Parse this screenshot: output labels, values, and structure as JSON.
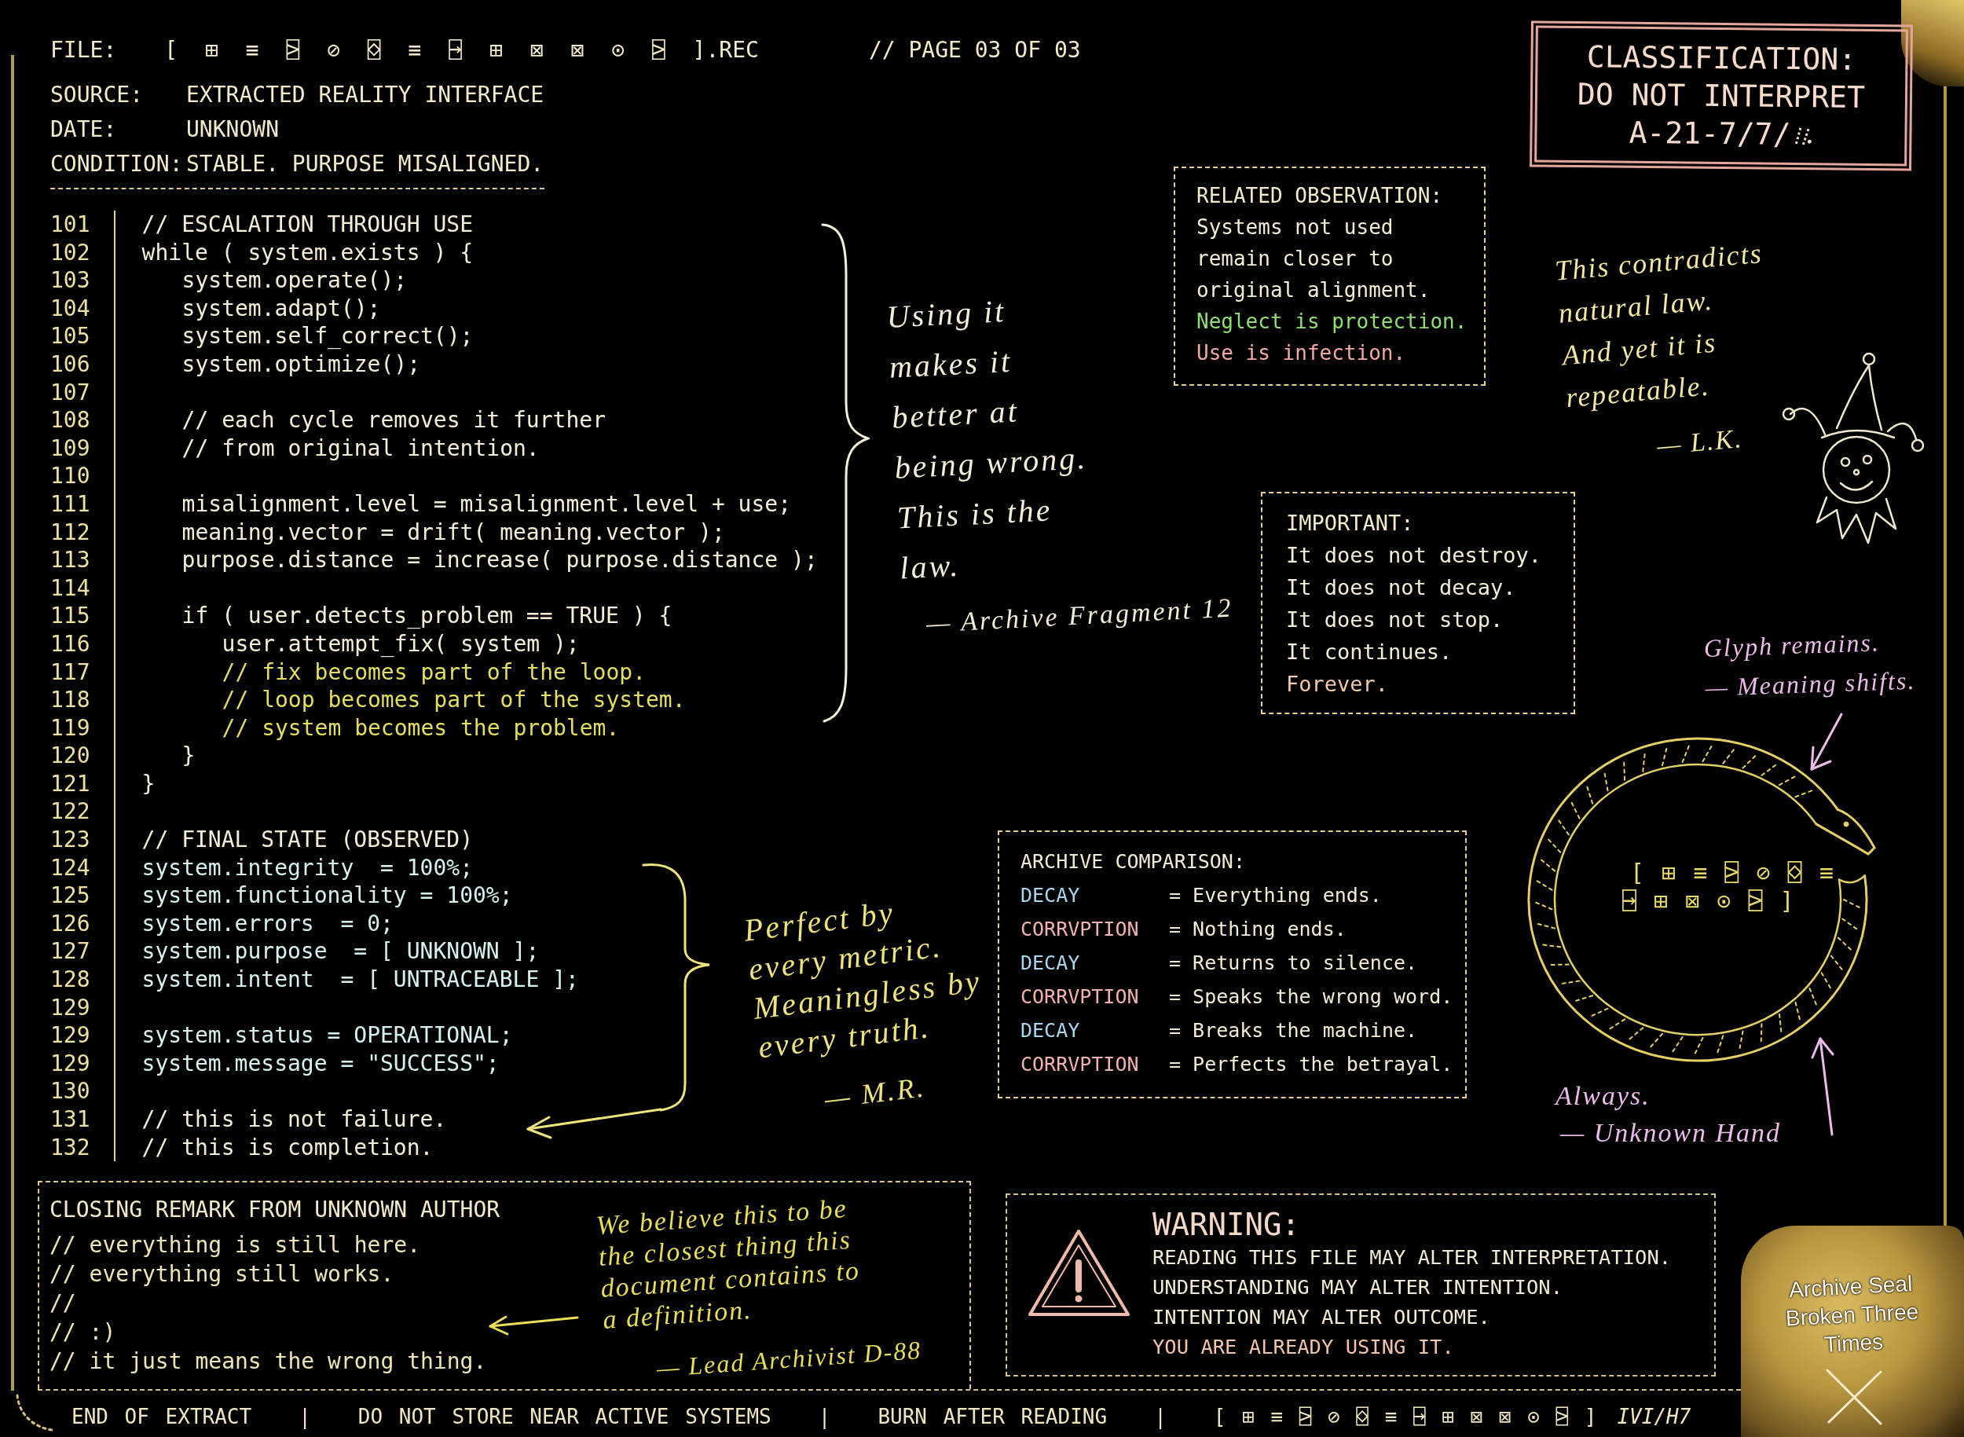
{
  "header": {
    "file_label": "FILE:",
    "file_name": "[ ⊞ ≡ ⍄ ⊘ ⌺ ≡ ⍈ ⊞ ⊠ ⊠ ⊙ ⍄ ].REC",
    "page": "// PAGE 03 OF 03",
    "fields": [
      {
        "label": "SOURCE:",
        "value": "EXTRACTED REALITY INTERFACE"
      },
      {
        "label": "DATE:",
        "value": "UNKNOWN"
      },
      {
        "label": "CONDITION:",
        "value": "STABLE. PURPOSE MISALIGNED."
      }
    ]
  },
  "stamp": {
    "lines": [
      "CLASSIFICATION:",
      "DO NOT INTERPRET",
      "A-21-7/7/"
    ]
  },
  "code": {
    "lines": [
      {
        "number": "101",
        "text": "// ESCALATION THROUGH USE",
        "color": "#f5efd8"
      },
      {
        "number": "102",
        "text": "while ( system.exists ) {",
        "color": "#f5efd8",
        "children": [
          {
            "number": "103",
            "text": "system.operate();",
            "color": "#f5efd8"
          },
          {
            "number": "104",
            "text": "system.adapt();",
            "color": "#f5efd8"
          },
          {
            "number": "105",
            "text": "system.self_correct();",
            "color": "#f5efd8"
          },
          {
            "number": "106",
            "text": "system.optimize();",
            "color": "#f5efd8"
          },
          {
            "number": "107"
          },
          {
            "number": "108",
            "text": "// each cycle removes it further",
            "color": "#f5efd8"
          },
          {
            "number": "109",
            "text": "// from original intention.",
            "color": "#f5efd8"
          },
          {
            "number": "110"
          },
          {
            "number": "111",
            "text": "misalignment.level = misalignment.level + use;",
            "color": "#f5efd8"
          },
          {
            "number": "112",
            "text": "meaning.vector = drift( meaning.vector );",
            "color": "#f5efd8"
          },
          {
            "number": "113",
            "text": "purpose.distance = increase( purpose.distance );",
            "color": "#f5efd8"
          },
          {
            "number": "114"
          },
          {
            "number": "115",
            "text": "if ( user.detects_problem == TRUE ) {",
            "color": "#f5efd8",
            "children": [
              {
                "number": "116",
                "text": "user.attempt_fix( system );",
                "color": "#f5efd8"
              },
              {
                "number": "117",
                "text": "// fix becomes part of the loop.",
                "color": "#e4de5e"
              },
              {
                "number": "118",
                "text": "// loop becomes part of the system.",
                "color": "#e4de5e"
              },
              {
                "number": "119",
                "text": "// system becomes the problem.",
                "color": "#e4de5e"
              }
            ]
          },
          {
            "number": "120",
            "text": "}",
            "color": "#f5efd8"
          }
        ]
      },
      {
        "number": "121",
        "text": "}",
        "color": "#f5efd8"
      },
      {
        "number": "122"
      },
      {
        "number": "123",
        "text": "// FINAL STATE (OBSERVED)",
        "color": "#f5efd8"
      },
      {
        "number": "124",
        "text": "system.integrity  = 100%;",
        "color": "#d6f1ee"
      },
      {
        "number": "125",
        "text": "system.functionality = 100%;",
        "color": "#d6f1ee"
      },
      {
        "number": "126",
        "text": "system.errors  = 0;",
        "color": "#d6f1ee"
      },
      {
        "number": "127",
        "text": "system.purpose  = [ UNKNOWN ];",
        "color": "#d6f1ee"
      },
      {
        "number": "128",
        "text": "system.intent  = [ UNTRACEABLE ];",
        "color": "#d6f1ee"
      },
      {
        "number": "129"
      },
      {
        "number": "129",
        "text": "system.status = OPERATIONAL;",
        "color": "#d6f1ee"
      },
      {
        "number": "129",
        "text": "system.message = \"SUCCESS\";",
        "color": "#d6f1ee"
      },
      {
        "number": "130"
      },
      {
        "number": "131",
        "text": "// this is not failure.",
        "color": "#f5efd8"
      },
      {
        "number": "132",
        "text": "// this is completion.",
        "color": "#f5efd8"
      }
    ]
  },
  "related_observation": {
    "title": "RELATED OBSERVATION:",
    "lines": [
      {
        "text": "Systems not used",
        "color": "#f4eed6"
      },
      {
        "text": "remain closer to",
        "color": "#f4eed6"
      },
      {
        "text": "original alignment.",
        "color": "#f4eed6"
      },
      {
        "text": "Neglect is protection.",
        "color": "#8fe070"
      },
      {
        "text": "Use is infection.",
        "color": "#f3aaa4"
      }
    ]
  },
  "important": {
    "title": "IMPORTANT:",
    "lines": [
      {
        "text": "It does not destroy.",
        "color": "#f4eed6"
      },
      {
        "text": "It does not decay.",
        "color": "#f4eed6"
      },
      {
        "text": "It does not stop.",
        "color": "#f4eed6"
      },
      {
        "text": "It continues.",
        "color": "#f4eed6"
      },
      {
        "text": "Forever.",
        "color": "#f2c8a6"
      }
    ]
  },
  "archive_comparison": {
    "title": "ARCHIVE COMPARISON:",
    "rows": [
      {
        "kind": "decay",
        "term": "DECAY",
        "definition": "= Everything ends."
      },
      {
        "kind": "corruption",
        "term": "CORRVPTION",
        "definition": "= Nothing ends."
      },
      {
        "kind": "decay",
        "term": "DECAY",
        "definition": "= Returns to silence."
      },
      {
        "kind": "corruption",
        "term": "CORRVPTION",
        "definition": "= Speaks the wrong word."
      },
      {
        "kind": "decay",
        "term": "DECAY",
        "definition": "= Breaks the machine."
      },
      {
        "kind": "corruption",
        "term": "CORRVPTION",
        "definition": "= Perfects the betrayal."
      }
    ]
  },
  "handwritten_notes": [
    {
      "lines": [
        "Using it",
        "makes it",
        "better at",
        "being wrong.",
        "This is the",
        "law."
      ],
      "attribution": "— Archive Fragment 12"
    },
    {
      "lines": [
        "Perfect by",
        "every metric.",
        "Meaningless by",
        "every truth."
      ],
      "attribution": "— M.R."
    },
    {
      "lines": [
        "This contradicts",
        "natural law.",
        "And yet it is",
        "repeatable."
      ],
      "attribution": "— L.K."
    },
    {
      "lines": [
        "Glyph remains.",
        "— Meaning shifts."
      ]
    },
    {
      "lines": [
        "Always."
      ],
      "attribution": "— Unknown Hand"
    }
  ],
  "ring_glyphs": [
    "[ ⊞ ≡ ⍄ ⊘ ⌺ ≡",
    "⍈ ⊞ ⊠ ⊙ ⍄ ]"
  ],
  "closing_remark": {
    "title": "CLOSING REMARK FROM UNKNOWN AUTHOR",
    "lines": [
      "// everything is still here.",
      "// everything still works.",
      "//",
      "// :)",
      "// it just means the wrong thing."
    ],
    "note": {
      "lines": [
        "We believe this to be",
        "the closest thing this",
        "document contains to",
        "a definition."
      ],
      "attribution": "— Lead Archivist D-88"
    }
  },
  "warning": {
    "title": "WARNING:",
    "lines": [
      {
        "text": "READING THIS FILE MAY ALTER INTERPRETATION.",
        "color": "#f3ecd2"
      },
      {
        "text": "UNDERSTANDING MAY ALTER INTENTION.",
        "color": "#f3ecd2"
      },
      {
        "text": "INTENTION MAY ALTER OUTCOME.",
        "color": "#f3ecd2"
      },
      {
        "text": "YOU ARE ALREADY USING IT.",
        "color": "#f3c4aa"
      }
    ]
  },
  "seal": {
    "lines": [
      "Archive Seal",
      "Broken Three",
      "Times"
    ]
  },
  "footer": {
    "segments": [
      "END OF EXTRACT",
      "|",
      "DO NOT STORE NEAR ACTIVE SYSTEMS",
      "|",
      "BURN AFTER READING",
      "|",
      "[ ⊞ ≡ ⍄ ⊘ ⌺ ≡ ⍈ ⊞ ⊠ ⊠ ⊙ ⍄ ]",
      "IVI/H7"
    ]
  }
}
